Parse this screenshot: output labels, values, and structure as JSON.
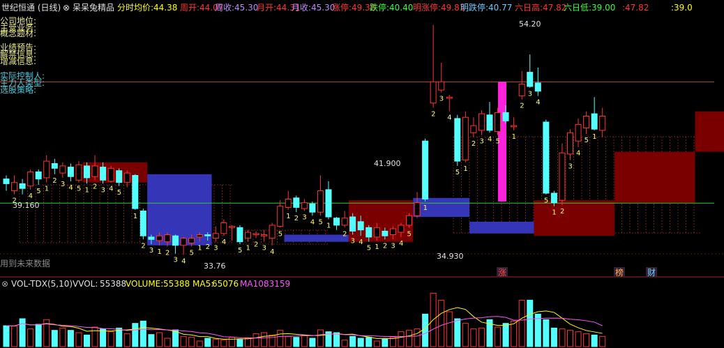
{
  "header": {
    "title": "世纪恒通 (日线)",
    "formula_name": "呆呆兔精品",
    "items": [
      {
        "label": "分时均价:",
        "value": "44.38",
        "color": "#ffff00"
      },
      {
        "label": "周开:",
        "value": "44.07",
        "color": "#ff3333"
      },
      {
        "label": "周收:",
        "value": "45.30",
        "color": "#bb88ff"
      },
      {
        "label": "月开:",
        "value": "44.31",
        "color": "#ff3333"
      },
      {
        "label": "月收:",
        "value": "45.30",
        "color": "#bb88ff"
      },
      {
        "label": "涨停:",
        "value": "49.38",
        "color": "#ff3333"
      },
      {
        "label": "跌停:",
        "value": "40.40",
        "color": "#33ff33"
      },
      {
        "label": "明涨停:",
        "value": "49.83",
        "color": "#ff3333"
      },
      {
        "label": "明跌停:",
        "value": "40.77",
        "color": "#66ccff"
      },
      {
        "label": "六日高:",
        "value": "47.82",
        "color": "#ff3333"
      },
      {
        "label": "六日低:",
        "value": "39.00",
        "color": "#33ff33"
      },
      {
        "label": ":",
        "value": "47.82",
        "color": "#ff3333"
      },
      {
        "label": ":",
        "value": "39.0",
        "color": "#ffff00"
      }
    ]
  },
  "left_labels": {
    "yellow": [
      "公司地位:",
      "主营业务:",
      "概念题材:",
      "业绩预告:",
      "解禁信息:",
      "增减信息:"
    ],
    "cyan": [
      "实际控制人:",
      "主力人类型:",
      "选股策略:"
    ]
  },
  "price_annotations": {
    "low1": "39.160",
    "high1": "41.900",
    "low2": "34.930",
    "low3": "33.76",
    "high2": "54.20",
    "future_text": "用到未来数据"
  },
  "markers": [
    {
      "text": "涨",
      "color": "#ff4444"
    },
    {
      "text": "榜",
      "color": "#ffaa55"
    },
    {
      "text": "财",
      "color": "#66ccff"
    }
  ],
  "volume_header": {
    "indicator": "VOL-TDX(5,10)",
    "vvol_label": "VVOL:",
    "vvol": "55388",
    "volume_label": "VOLUME:",
    "volume": "55388",
    "ma5_label": "MA5:",
    "ma5": "65076",
    "ma10_label": "MA10:",
    "ma10": "83159"
  },
  "colors": {
    "up": "#ff3333",
    "down": "#54ffff",
    "background": "#000000",
    "ma5": "#ffff00",
    "ma10": "#ff55ff",
    "box_red": "#7a0000",
    "box_blue": "#3535b8",
    "support_line": "#33cc33",
    "resistance_line": "#cc3333"
  },
  "chart_data": {
    "type": "candlestick",
    "title": "世纪恒通 (日线)",
    "candles": [
      {
        "o": 41.2,
        "c": 40.8,
        "h": 41.5,
        "l": 40.2,
        "num": ""
      },
      {
        "o": 40.2,
        "c": 40.9,
        "h": 41.5,
        "l": 39.9,
        "num": "2"
      },
      {
        "o": 40.8,
        "c": 40.4,
        "h": 41.2,
        "l": 39.9,
        "num": ""
      },
      {
        "o": 40.6,
        "c": 41.8,
        "h": 42.0,
        "l": 40.3,
        "num": "4"
      },
      {
        "o": 41.8,
        "c": 41.2,
        "h": 42.0,
        "l": 40.7,
        "num": "5"
      },
      {
        "o": 41.3,
        "c": 42.7,
        "h": 43.2,
        "l": 40.9,
        "num": "1"
      },
      {
        "o": 42.5,
        "c": 42.1,
        "h": 42.9,
        "l": 41.6,
        "num": "2"
      },
      {
        "o": 41.7,
        "c": 42.3,
        "h": 42.6,
        "l": 41.3,
        "num": "3"
      },
      {
        "o": 42.2,
        "c": 41.4,
        "h": 42.5,
        "l": 41.0,
        "num": "4"
      },
      {
        "o": 41.1,
        "c": 42.4,
        "h": 42.7,
        "l": 40.9,
        "num": "5"
      },
      {
        "o": 42.3,
        "c": 41.3,
        "h": 42.6,
        "l": 40.8,
        "num": "1"
      },
      {
        "o": 41.4,
        "c": 42.3,
        "h": 43.2,
        "l": 41.1,
        "num": "2"
      },
      {
        "o": 42.2,
        "c": 41.1,
        "h": 42.6,
        "l": 40.8,
        "num": "3"
      },
      {
        "o": 41.0,
        "c": 42.1,
        "h": 42.3,
        "l": 40.9,
        "num": "4"
      },
      {
        "o": 41.9,
        "c": 40.9,
        "h": 42.1,
        "l": 40.6,
        "num": "5"
      },
      {
        "o": 40.9,
        "c": 41.7,
        "h": 41.9,
        "l": 40.5,
        "num": ""
      },
      {
        "o": 41.5,
        "c": 38.7,
        "h": 41.6,
        "l": 38.6,
        "num": "1"
      },
      {
        "o": 38.5,
        "c": 36.4,
        "h": 38.7,
        "l": 36.1,
        "num": "2"
      },
      {
        "o": 36.3,
        "c": 36.1,
        "h": 36.5,
        "l": 35.7,
        "num": "3"
      },
      {
        "o": 36.0,
        "c": 36.4,
        "h": 36.7,
        "l": 35.6,
        "num": "1"
      },
      {
        "o": 35.9,
        "c": 36.5,
        "h": 36.7,
        "l": 35.5,
        "num": "2"
      },
      {
        "o": 36.4,
        "c": 35.6,
        "h": 36.5,
        "l": 34.9,
        "num": "3"
      },
      {
        "o": 35.6,
        "c": 36.2,
        "h": 36.3,
        "l": 34.8,
        "num": "4"
      },
      {
        "o": 35.8,
        "c": 36.2,
        "h": 36.5,
        "l": 35.5,
        "num": "5"
      },
      {
        "o": 36.3,
        "c": 36.5,
        "h": 36.7,
        "l": 35.9,
        "num": "1"
      },
      {
        "o": 36.5,
        "c": 36.4,
        "h": 36.7,
        "l": 36.0,
        "num": "2"
      },
      {
        "o": 36.2,
        "c": 36.6,
        "h": 37.2,
        "l": 35.9,
        "num": "3"
      },
      {
        "o": 36.6,
        "c": 37.5,
        "h": 37.8,
        "l": 36.4,
        "num": "4"
      },
      {
        "o": 37.1,
        "c": 37.2,
        "h": 37.3,
        "l": 36.0,
        "num": ""
      },
      {
        "o": 37.1,
        "c": 35.9,
        "h": 37.3,
        "l": 35.7,
        "num": "5"
      },
      {
        "o": 36.2,
        "c": 36.7,
        "h": 36.9,
        "l": 35.9,
        "num": "1"
      },
      {
        "o": 36.5,
        "c": 36.6,
        "h": 36.8,
        "l": 36.2,
        "num": "2"
      },
      {
        "o": 36.4,
        "c": 36.5,
        "h": 36.9,
        "l": 35.9,
        "num": "3"
      },
      {
        "o": 36.2,
        "c": 37.3,
        "h": 37.5,
        "l": 35.6,
        "num": "4"
      },
      {
        "o": 37.2,
        "c": 38.9,
        "h": 39.4,
        "l": 37.1,
        "num": "5"
      },
      {
        "o": 38.8,
        "c": 39.5,
        "h": 40.2,
        "l": 38.6,
        "num": "1"
      },
      {
        "o": 39.6,
        "c": 38.8,
        "h": 39.8,
        "l": 38.4,
        "num": "2"
      },
      {
        "o": 38.7,
        "c": 39.2,
        "h": 39.5,
        "l": 38.5,
        "num": "3"
      },
      {
        "o": 39.1,
        "c": 38.4,
        "h": 39.3,
        "l": 38.1,
        "num": "4"
      },
      {
        "o": 38.4,
        "c": 40.2,
        "h": 41.5,
        "l": 38.1,
        "num": "5"
      },
      {
        "o": 40.3,
        "c": 38.0,
        "h": 41.0,
        "l": 37.8,
        "num": "1"
      },
      {
        "o": 37.9,
        "c": 37.3,
        "h": 38.0,
        "l": 36.9,
        "num": ""
      },
      {
        "o": 37.3,
        "c": 37.9,
        "h": 38.5,
        "l": 37.1,
        "num": "2"
      },
      {
        "o": 38.0,
        "c": 36.8,
        "h": 38.3,
        "l": 36.5,
        "num": "3"
      },
      {
        "o": 37.6,
        "c": 36.9,
        "h": 38.1,
        "l": 36.4,
        "num": "4"
      },
      {
        "o": 37.1,
        "c": 36.3,
        "h": 37.3,
        "l": 35.9,
        "num": "5"
      },
      {
        "o": 36.3,
        "c": 37.1,
        "h": 37.5,
        "l": 36.0,
        "num": "1"
      },
      {
        "o": 36.8,
        "c": 36.4,
        "h": 37.1,
        "l": 36.1,
        "num": "2"
      },
      {
        "o": 36.5,
        "c": 37.0,
        "h": 37.2,
        "l": 36.1,
        "num": "3"
      },
      {
        "o": 36.7,
        "c": 37.3,
        "h": 37.5,
        "l": 36.3,
        "num": "4"
      },
      {
        "o": 37.3,
        "c": 38.1,
        "h": 38.3,
        "l": 37.1,
        "num": "5"
      },
      {
        "o": 38.1,
        "c": 39.2,
        "h": 40.1,
        "l": 37.9,
        "num": ""
      },
      {
        "o": 44.4,
        "c": 39.5,
        "h": 44.6,
        "l": 39.3,
        "num": "1"
      },
      {
        "o": 47.6,
        "c": 49.4,
        "h": 54.2,
        "l": 47.2,
        "num": "2"
      },
      {
        "o": 48.7,
        "c": 49.4,
        "h": 51.0,
        "l": 48.5,
        "num": "3"
      },
      {
        "o": 48.0,
        "c": 48.1,
        "h": 48.3,
        "l": 46.9,
        "num": "4"
      },
      {
        "o": 46.3,
        "c": 42.7,
        "h": 46.6,
        "l": 42.3,
        "num": "5"
      },
      {
        "o": 42.8,
        "c": 46.4,
        "h": 46.9,
        "l": 42.6,
        "num": "1"
      },
      {
        "o": 45.1,
        "c": 45.7,
        "h": 46.4,
        "l": 44.7,
        "num": "2"
      },
      {
        "o": 45.3,
        "c": 46.7,
        "h": 47.0,
        "l": 44.9,
        "num": "3"
      },
      {
        "o": 46.6,
        "c": 45.3,
        "h": 47.7,
        "l": 45.1,
        "num": "4"
      },
      {
        "o": 45.2,
        "c": 46.8,
        "h": 47.2,
        "l": 44.9,
        "num": "5"
      },
      {
        "o": 46.8,
        "c": 46.1,
        "h": 47.4,
        "l": 45.9,
        "num": ""
      },
      {
        "o": 45.6,
        "c": 45.7,
        "h": 46.4,
        "l": 45.3,
        "num": "1"
      },
      {
        "o": 48.2,
        "c": 49.2,
        "h": 50.3,
        "l": 47.9,
        "num": "2"
      },
      {
        "o": 50.2,
        "c": 49.0,
        "h": 51.7,
        "l": 48.9,
        "num": "3"
      },
      {
        "o": 49.3,
        "c": 48.6,
        "h": 50.6,
        "l": 48.2,
        "num": "4"
      },
      {
        "o": 46.0,
        "c": 40.0,
        "h": 46.2,
        "l": 39.9,
        "num": "5"
      },
      {
        "o": 40.0,
        "c": 39.2,
        "h": 40.2,
        "l": 38.9,
        "num": "1"
      },
      {
        "o": 39.4,
        "c": 43.4,
        "h": 44.2,
        "l": 39.0,
        "num": "2"
      },
      {
        "o": 43.3,
        "c": 45.1,
        "h": 45.4,
        "l": 42.8,
        "num": "3"
      },
      {
        "o": 44.4,
        "c": 45.8,
        "h": 46.3,
        "l": 43.9,
        "num": "4"
      },
      {
        "o": 45.5,
        "c": 46.5,
        "h": 46.9,
        "l": 45.0,
        "num": "5"
      },
      {
        "o": 46.7,
        "c": 45.4,
        "h": 48.1,
        "l": 45.3,
        "num": "1"
      },
      {
        "o": 45.3,
        "c": 46.5,
        "h": 47.2,
        "l": 44.7,
        "num": ""
      }
    ],
    "volume": [
      45,
      44,
      60,
      38,
      48,
      58,
      35,
      40,
      35,
      30,
      25,
      42,
      38,
      32,
      40,
      28,
      50,
      55,
      26,
      30,
      18,
      36,
      22,
      20,
      12,
      18,
      16,
      14,
      20,
      15,
      18,
      28,
      30,
      25,
      35,
      22,
      20,
      24,
      18,
      36,
      32,
      30,
      14,
      22,
      18,
      20,
      12,
      16,
      20,
      32,
      35,
      38,
      70,
      115,
      100,
      75,
      60,
      50,
      38,
      40,
      58,
      42,
      50,
      55,
      100,
      100,
      70,
      58,
      40,
      38,
      35,
      32,
      28,
      25,
      22
    ],
    "boxes": [
      {
        "type": "red",
        "from": 10,
        "to": 18,
        "top": 42.6,
        "bottom": 40.9
      },
      {
        "type": "blue",
        "from": 18,
        "to": 26,
        "top": 41.6,
        "bottom": 35.6
      },
      {
        "type": "blue",
        "from": 35,
        "to": 43,
        "top": 36.5,
        "bottom": 35.9
      },
      {
        "type": "red",
        "from": 43,
        "to": 51,
        "top": 39.4,
        "bottom": 35.9
      },
      {
        "type": "blue",
        "from": 51,
        "to": 58,
        "top": 39.6,
        "bottom": 38.0
      },
      {
        "type": "blue",
        "from": 58,
        "to": 66,
        "top": 37.6,
        "bottom": 36.6
      },
      {
        "type": "red",
        "from": 66,
        "to": 76,
        "top": 39.4,
        "bottom": 36.4
      },
      {
        "type": "red",
        "from": 76,
        "to": 86,
        "top": 43.5,
        "bottom": 39.2
      },
      {
        "type": "red",
        "from": 86,
        "to": 94,
        "top": 46.9,
        "bottom": 43.5
      },
      {
        "type": "blue",
        "from": 94,
        "to": 103,
        "top": 45.2,
        "bottom": 42.6
      },
      {
        "type": "blue",
        "from": 103,
        "to": 111,
        "top": 46.6,
        "bottom": 45.9
      }
    ],
    "ylim": [
      33.0,
      55.0
    ],
    "horizontal_lines": [
      39.16,
      49.38
    ]
  }
}
